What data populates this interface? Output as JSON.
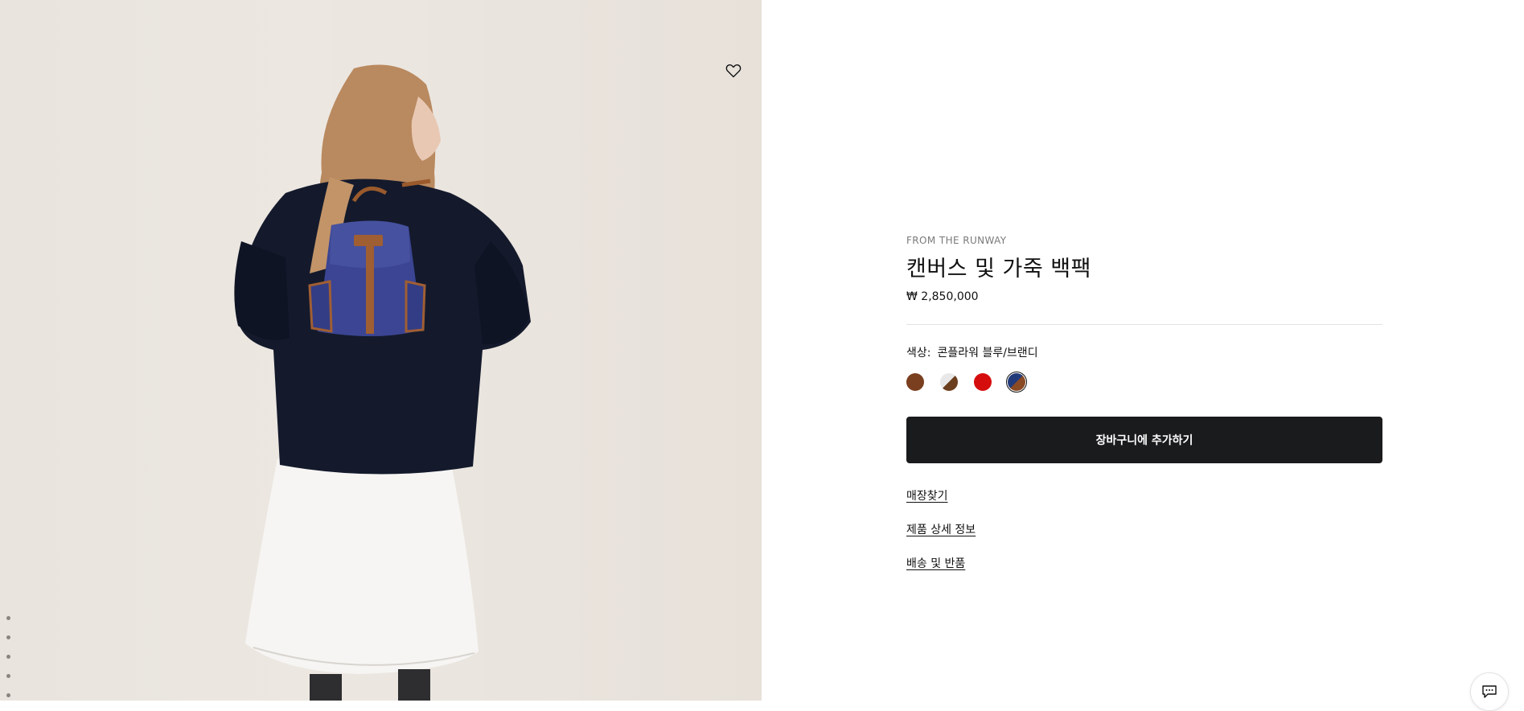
{
  "product": {
    "eyebrow": "FROM THE RUNWAY",
    "title": "캔버스 및 가죽 백팩",
    "price": "₩ 2,850,000",
    "color_label": "색상:",
    "color_value": "콘플라워 블루/브랜디",
    "swatches": [
      {
        "name": "brown",
        "color": "#7a3f1f"
      },
      {
        "name": "white-brown",
        "color": "#e8e8e8",
        "color2": "#6b3e1e"
      },
      {
        "name": "red",
        "color": "#d60d0d"
      },
      {
        "name": "cornflower-blue-brandy",
        "color": "#213b7a",
        "color2": "#8a4a24",
        "selected": true
      }
    ]
  },
  "actions": {
    "add_to_cart": "장바구니에 추가하기",
    "find_store": "매장찾기",
    "product_details": "제품 상세 정보",
    "shipping_returns": "배송 및 반품"
  },
  "gallery": {
    "image_count": 5,
    "wishlist_icon": "heart-icon",
    "chat_icon": "chat-icon"
  }
}
